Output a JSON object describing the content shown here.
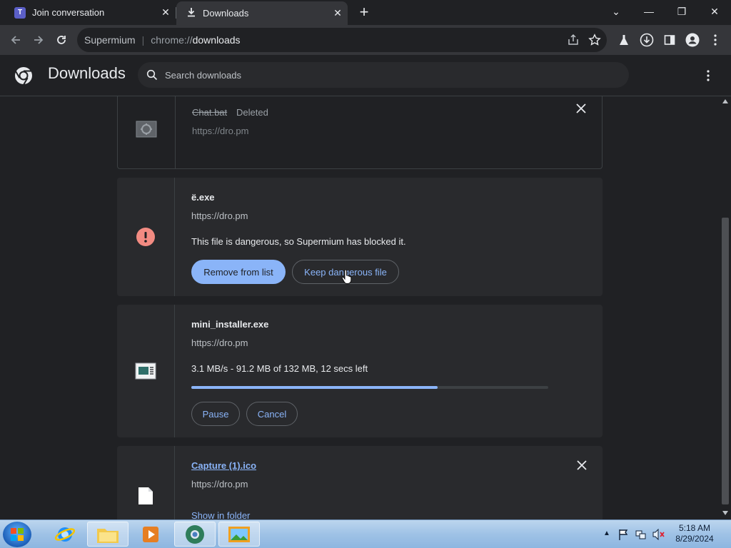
{
  "tabs": [
    {
      "title": "Join conversation",
      "close": "✕"
    },
    {
      "title": "Downloads",
      "close": "✕"
    }
  ],
  "new_tab": "+",
  "window_controls": {
    "list": "⌄",
    "minimize": "—",
    "restore": "❐",
    "close": "✕"
  },
  "omnibox": {
    "site": "Supermium",
    "divider": "|",
    "scheme": "chrome://",
    "path": "downloads"
  },
  "header": {
    "title": "Downloads",
    "search_placeholder": "Search downloads"
  },
  "downloads": [
    {
      "name": "Chat.bat",
      "status": "Deleted",
      "url": "https://dro.pm",
      "icon": "bat-file-icon"
    },
    {
      "name": "ë.exe",
      "url": "https://dro.pm",
      "warning": "This file is dangerous, so Supermium has blocked it.",
      "remove_label": "Remove from list",
      "keep_label": "Keep dangerous file",
      "icon": "danger-icon"
    },
    {
      "name": "mini_installer.exe",
      "url": "https://dro.pm",
      "progress_text": "3.1 MB/s - 91.2 MB of 132 MB, 12 secs left",
      "progress_fraction": 0.69,
      "pause_label": "Pause",
      "cancel_label": "Cancel",
      "icon": "installer-icon"
    },
    {
      "name": "Capture (1).ico",
      "url": "https://dro.pm",
      "show_label": "Show in folder",
      "icon": "file-icon"
    }
  ],
  "taskbar": {
    "time": "5:18 AM",
    "date": "8/29/2024"
  },
  "colors": {
    "accent": "#8ab4f8",
    "background": "#202124",
    "card": "#292a2d",
    "danger": "#f28b82",
    "progress_track": "#3c4043"
  }
}
